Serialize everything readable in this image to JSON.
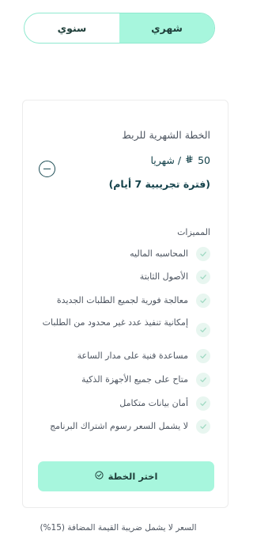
{
  "billing_toggle": {
    "monthly_label": "شهري",
    "yearly_label": "سنوي",
    "selected": "monthly"
  },
  "plan": {
    "title": "الخطة الشهرية للربط",
    "price_amount": "50",
    "currency_symbol": "⃁",
    "price_period": "/ شهريا",
    "trial_label": "(فترة تجريبية 7 أيام)",
    "features_heading": "المميزات",
    "features": [
      "المحاسبه الماليه",
      "الأصول الثابتة",
      "معالجة فورية لجميع الطلبات الجديدة",
      "إمكانية تنفيذ عدد غير محدود من الطلبات",
      "مساعدة فنية على مدار الساعة",
      "متاح على جميع الأجهزة الذكية",
      "أمان بيانات متكامل",
      "لا يشمل السعر رسوم اشتراك البرنامج"
    ],
    "choose_button_label": "اختر الخطة"
  },
  "footer_note": "السعر لا يشمل ضريبة القيمة المضافة (15%)",
  "colors": {
    "accent": "#a7f6dd",
    "accent_border": "#8fe9cf",
    "dark_text": "#14424b",
    "check_bg": "#e8f6f0"
  }
}
